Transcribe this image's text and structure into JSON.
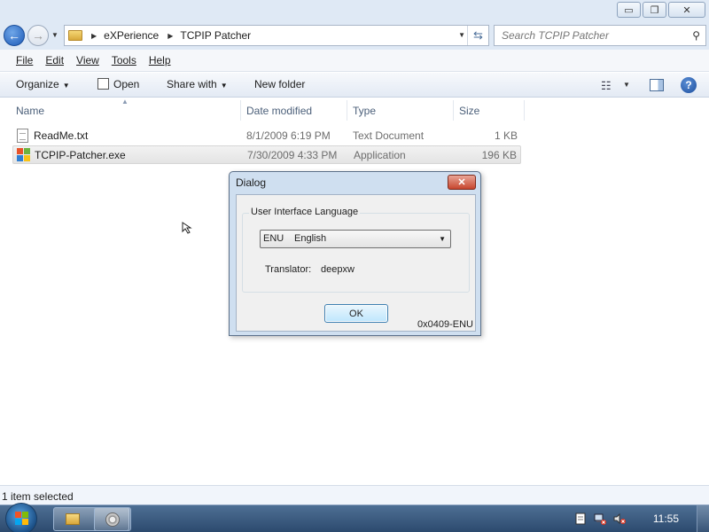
{
  "window": {
    "controls": {
      "minimize": "▭",
      "restore": "❐",
      "close": "✕"
    }
  },
  "address": {
    "crumbs": [
      "eXPerience",
      "TCPIP Patcher"
    ],
    "refresh_glyph": "⇆"
  },
  "search": {
    "placeholder": "Search TCPIP Patcher"
  },
  "menubar": {
    "items": [
      {
        "label": "File",
        "accel": "F"
      },
      {
        "label": "Edit",
        "accel": "E"
      },
      {
        "label": "View",
        "accel": "V"
      },
      {
        "label": "Tools",
        "accel": "T"
      },
      {
        "label": "Help",
        "accel": "H"
      }
    ]
  },
  "commandbar": {
    "organize": "Organize",
    "open": "Open",
    "share_with": "Share with",
    "new_folder": "New folder"
  },
  "columns": {
    "name": "Name",
    "date": "Date modified",
    "type": "Type",
    "size": "Size"
  },
  "files": [
    {
      "name": "ReadMe.txt",
      "date": "8/1/2009 6:19 PM",
      "type": "Text Document",
      "size": "1 KB",
      "icon": "text-file-icon",
      "selected": false
    },
    {
      "name": "TCPIP-Patcher.exe",
      "date": "7/30/2009 4:33 PM",
      "type": "Application",
      "size": "196 KB",
      "icon": "application-icon",
      "selected": true
    }
  ],
  "dialog": {
    "title": "Dialog",
    "group_label": "User Interface Language",
    "language_code": "ENU",
    "language_name": "English",
    "translator_label": "Translator:",
    "translator_name": "deepxw",
    "ok_label": "OK",
    "locale_code": "0x0409-ENU"
  },
  "status": {
    "text": "1 item selected"
  },
  "taskbar": {
    "clock": "11:55"
  },
  "colors": {
    "accent": "#1d5bb8",
    "close_red": "#c7452e",
    "taskbar": "#2c4a6e"
  }
}
